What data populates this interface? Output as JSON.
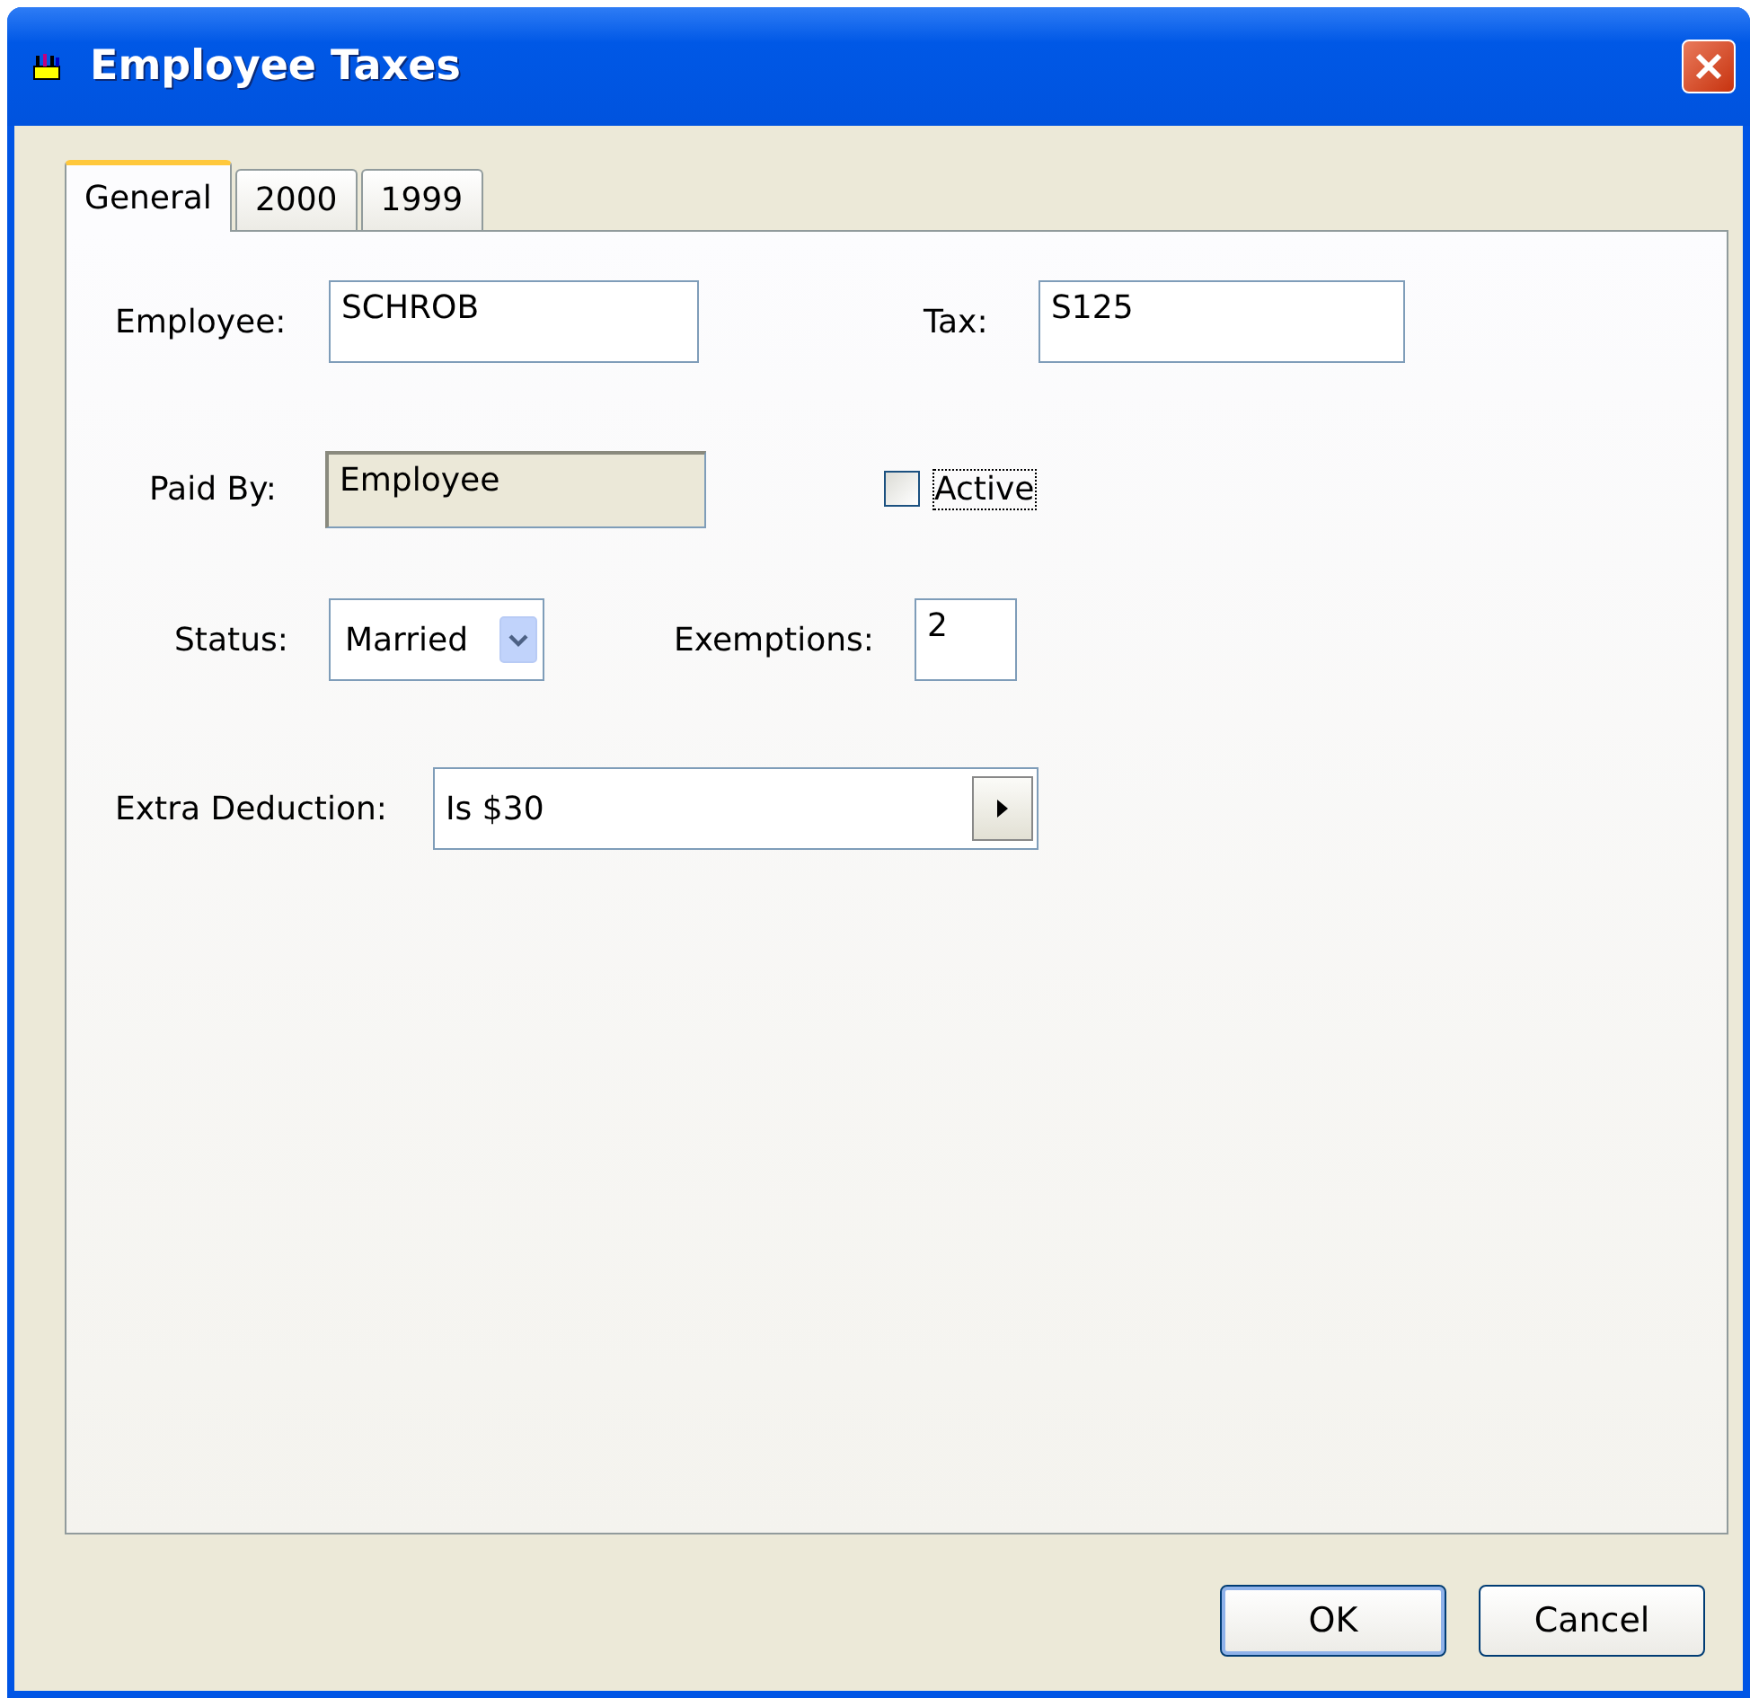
{
  "window": {
    "title": "Employee Taxes"
  },
  "tabs": [
    {
      "label": "General",
      "selected": true
    },
    {
      "label": "2000",
      "selected": false
    },
    {
      "label": "1999",
      "selected": false
    }
  ],
  "form": {
    "employee": {
      "label": "Employee:",
      "value": "SCHROB"
    },
    "tax": {
      "label": "Tax:",
      "value": "S125"
    },
    "paid_by": {
      "label": "Paid By:",
      "value": "Employee",
      "disabled": true
    },
    "active": {
      "label": "Active",
      "checked": false
    },
    "status": {
      "label": "Status:",
      "value": "Married"
    },
    "exemptions": {
      "label": "Exemptions:",
      "value": "2"
    },
    "extra_deduction": {
      "label": "Extra Deduction:",
      "value": "Is $30"
    }
  },
  "buttons": [
    {
      "label": "OK",
      "default": true
    },
    {
      "label": "Cancel",
      "default": false
    }
  ]
}
